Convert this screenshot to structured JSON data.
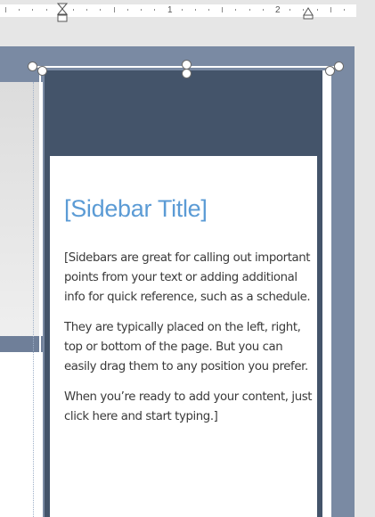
{
  "ruler": {
    "marks": [
      "1",
      "2"
    ]
  },
  "sidebar": {
    "title": "[Sidebar Title]",
    "paragraphs": [
      "[Sidebars are great for calling out important points from your text or adding additional info for quick reference, such as a schedule.",
      "They are typically placed on the left, right, top or bottom of the page. But you can easily drag them to any position you prefer.",
      "When you’re ready to add your content, just click here and start typing.]"
    ]
  },
  "colors": {
    "accent_dark": "#44546a",
    "title_blue": "#5b9bd5",
    "band": "#7a8aa3"
  }
}
